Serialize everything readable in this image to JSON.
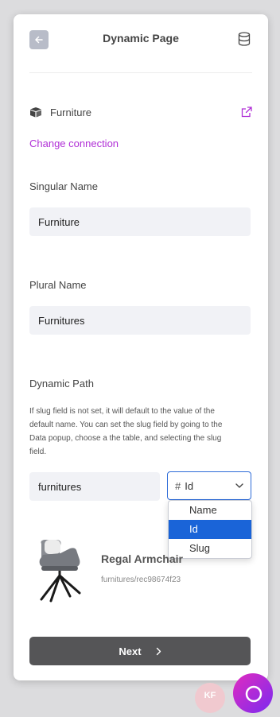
{
  "header": {
    "title": "Dynamic Page"
  },
  "connection": {
    "name": "Furniture",
    "change_label": "Change connection"
  },
  "singular": {
    "label": "Singular Name",
    "value": "Furniture"
  },
  "plural": {
    "label": "Plural Name",
    "value": "Furnitures"
  },
  "dynamic_path": {
    "label": "Dynamic Path",
    "help": "If slug field is not set, it will default to the value of the default name. You can set the slug field by going to the Data popup, choose a the table, and selecting the slug field.",
    "prefix_value": "furnitures",
    "field_select": {
      "icon": "#",
      "value": "Id",
      "options": [
        "Name",
        "Id",
        "Slug"
      ]
    }
  },
  "preview": {
    "title": "Regal Armchair",
    "path": "furnitures/rec98674f23"
  },
  "next_label": "Next",
  "avatar_initials": "KF",
  "colors": {
    "accent": "#b02fd6",
    "selected": "#1a64d8",
    "button": "#555557"
  }
}
